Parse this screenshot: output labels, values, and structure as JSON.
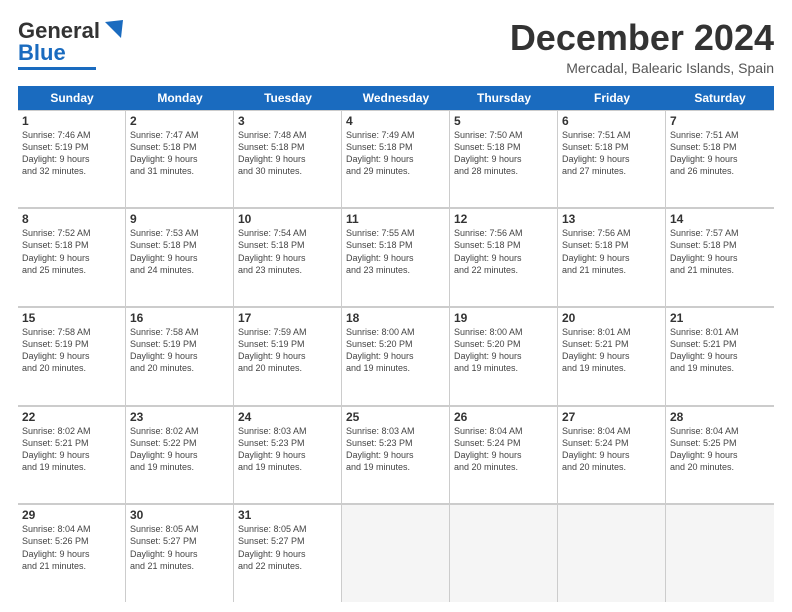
{
  "header": {
    "logo_line1": "General",
    "logo_line2": "Blue",
    "month_title": "December 2024",
    "location": "Mercadal, Balearic Islands, Spain"
  },
  "weekdays": [
    "Sunday",
    "Monday",
    "Tuesday",
    "Wednesday",
    "Thursday",
    "Friday",
    "Saturday"
  ],
  "weeks": [
    [
      {
        "day": "1",
        "lines": [
          "Sunrise: 7:46 AM",
          "Sunset: 5:19 PM",
          "Daylight: 9 hours",
          "and 32 minutes."
        ]
      },
      {
        "day": "2",
        "lines": [
          "Sunrise: 7:47 AM",
          "Sunset: 5:18 PM",
          "Daylight: 9 hours",
          "and 31 minutes."
        ]
      },
      {
        "day": "3",
        "lines": [
          "Sunrise: 7:48 AM",
          "Sunset: 5:18 PM",
          "Daylight: 9 hours",
          "and 30 minutes."
        ]
      },
      {
        "day": "4",
        "lines": [
          "Sunrise: 7:49 AM",
          "Sunset: 5:18 PM",
          "Daylight: 9 hours",
          "and 29 minutes."
        ]
      },
      {
        "day": "5",
        "lines": [
          "Sunrise: 7:50 AM",
          "Sunset: 5:18 PM",
          "Daylight: 9 hours",
          "and 28 minutes."
        ]
      },
      {
        "day": "6",
        "lines": [
          "Sunrise: 7:51 AM",
          "Sunset: 5:18 PM",
          "Daylight: 9 hours",
          "and 27 minutes."
        ]
      },
      {
        "day": "7",
        "lines": [
          "Sunrise: 7:51 AM",
          "Sunset: 5:18 PM",
          "Daylight: 9 hours",
          "and 26 minutes."
        ]
      }
    ],
    [
      {
        "day": "8",
        "lines": [
          "Sunrise: 7:52 AM",
          "Sunset: 5:18 PM",
          "Daylight: 9 hours",
          "and 25 minutes."
        ]
      },
      {
        "day": "9",
        "lines": [
          "Sunrise: 7:53 AM",
          "Sunset: 5:18 PM",
          "Daylight: 9 hours",
          "and 24 minutes."
        ]
      },
      {
        "day": "10",
        "lines": [
          "Sunrise: 7:54 AM",
          "Sunset: 5:18 PM",
          "Daylight: 9 hours",
          "and 23 minutes."
        ]
      },
      {
        "day": "11",
        "lines": [
          "Sunrise: 7:55 AM",
          "Sunset: 5:18 PM",
          "Daylight: 9 hours",
          "and 23 minutes."
        ]
      },
      {
        "day": "12",
        "lines": [
          "Sunrise: 7:56 AM",
          "Sunset: 5:18 PM",
          "Daylight: 9 hours",
          "and 22 minutes."
        ]
      },
      {
        "day": "13",
        "lines": [
          "Sunrise: 7:56 AM",
          "Sunset: 5:18 PM",
          "Daylight: 9 hours",
          "and 21 minutes."
        ]
      },
      {
        "day": "14",
        "lines": [
          "Sunrise: 7:57 AM",
          "Sunset: 5:18 PM",
          "Daylight: 9 hours",
          "and 21 minutes."
        ]
      }
    ],
    [
      {
        "day": "15",
        "lines": [
          "Sunrise: 7:58 AM",
          "Sunset: 5:19 PM",
          "Daylight: 9 hours",
          "and 20 minutes."
        ]
      },
      {
        "day": "16",
        "lines": [
          "Sunrise: 7:58 AM",
          "Sunset: 5:19 PM",
          "Daylight: 9 hours",
          "and 20 minutes."
        ]
      },
      {
        "day": "17",
        "lines": [
          "Sunrise: 7:59 AM",
          "Sunset: 5:19 PM",
          "Daylight: 9 hours",
          "and 20 minutes."
        ]
      },
      {
        "day": "18",
        "lines": [
          "Sunrise: 8:00 AM",
          "Sunset: 5:20 PM",
          "Daylight: 9 hours",
          "and 19 minutes."
        ]
      },
      {
        "day": "19",
        "lines": [
          "Sunrise: 8:00 AM",
          "Sunset: 5:20 PM",
          "Daylight: 9 hours",
          "and 19 minutes."
        ]
      },
      {
        "day": "20",
        "lines": [
          "Sunrise: 8:01 AM",
          "Sunset: 5:21 PM",
          "Daylight: 9 hours",
          "and 19 minutes."
        ]
      },
      {
        "day": "21",
        "lines": [
          "Sunrise: 8:01 AM",
          "Sunset: 5:21 PM",
          "Daylight: 9 hours",
          "and 19 minutes."
        ]
      }
    ],
    [
      {
        "day": "22",
        "lines": [
          "Sunrise: 8:02 AM",
          "Sunset: 5:21 PM",
          "Daylight: 9 hours",
          "and 19 minutes."
        ]
      },
      {
        "day": "23",
        "lines": [
          "Sunrise: 8:02 AM",
          "Sunset: 5:22 PM",
          "Daylight: 9 hours",
          "and 19 minutes."
        ]
      },
      {
        "day": "24",
        "lines": [
          "Sunrise: 8:03 AM",
          "Sunset: 5:23 PM",
          "Daylight: 9 hours",
          "and 19 minutes."
        ]
      },
      {
        "day": "25",
        "lines": [
          "Sunrise: 8:03 AM",
          "Sunset: 5:23 PM",
          "Daylight: 9 hours",
          "and 19 minutes."
        ]
      },
      {
        "day": "26",
        "lines": [
          "Sunrise: 8:04 AM",
          "Sunset: 5:24 PM",
          "Daylight: 9 hours",
          "and 20 minutes."
        ]
      },
      {
        "day": "27",
        "lines": [
          "Sunrise: 8:04 AM",
          "Sunset: 5:24 PM",
          "Daylight: 9 hours",
          "and 20 minutes."
        ]
      },
      {
        "day": "28",
        "lines": [
          "Sunrise: 8:04 AM",
          "Sunset: 5:25 PM",
          "Daylight: 9 hours",
          "and 20 minutes."
        ]
      }
    ],
    [
      {
        "day": "29",
        "lines": [
          "Sunrise: 8:04 AM",
          "Sunset: 5:26 PM",
          "Daylight: 9 hours",
          "and 21 minutes."
        ]
      },
      {
        "day": "30",
        "lines": [
          "Sunrise: 8:05 AM",
          "Sunset: 5:27 PM",
          "Daylight: 9 hours",
          "and 21 minutes."
        ]
      },
      {
        "day": "31",
        "lines": [
          "Sunrise: 8:05 AM",
          "Sunset: 5:27 PM",
          "Daylight: 9 hours",
          "and 22 minutes."
        ]
      },
      {
        "day": "",
        "lines": []
      },
      {
        "day": "",
        "lines": []
      },
      {
        "day": "",
        "lines": []
      },
      {
        "day": "",
        "lines": []
      }
    ]
  ]
}
